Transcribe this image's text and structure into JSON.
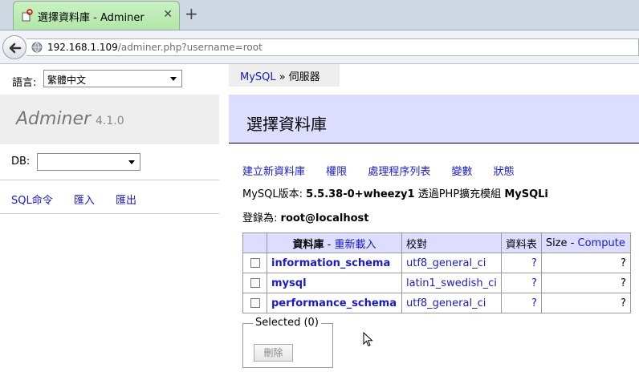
{
  "browser": {
    "tab_title": "選擇資料庫 - Adminer",
    "url_host": "192.168.1.109",
    "url_path": "/adminer.php?username=root"
  },
  "sidebar": {
    "lang_label": "語言:",
    "lang_value": "繁體中文",
    "brand": "Adminer",
    "version": "4.1.0",
    "db_label": "DB:",
    "links": [
      "SQL命令",
      "匯入",
      "匯出"
    ]
  },
  "breadcrumb": {
    "server": "MySQL",
    "separator": "»",
    "current": "伺服器"
  },
  "main": {
    "title": "選擇資料庫",
    "links": [
      "建立新資料庫",
      "權限",
      "處理程序列表",
      "變數",
      "狀態"
    ],
    "version_label": "MySQL版本:",
    "version_value": "5.5.38-0+wheezy1",
    "ext_label": "透過PHP擴充模組",
    "ext_value": "MySQLi",
    "login_label": "登錄為:",
    "login_value": "root@localhost"
  },
  "table": {
    "headers": {
      "database": "資料庫",
      "dash": "-",
      "reload": "重新載入",
      "collation": "校對",
      "tables": "資料表",
      "size": "Size",
      "compute": "Compute"
    },
    "rows": [
      {
        "name": "information_schema",
        "collation": "utf8_general_ci",
        "tables": "?",
        "size": "?"
      },
      {
        "name": "mysql",
        "collation": "latin1_swedish_ci",
        "tables": "?",
        "size": "?"
      },
      {
        "name": "performance_schema",
        "collation": "utf8_general_ci",
        "tables": "?",
        "size": "?"
      }
    ]
  },
  "selected": {
    "legend": "Selected (0)",
    "delete_label": "刪除"
  }
}
